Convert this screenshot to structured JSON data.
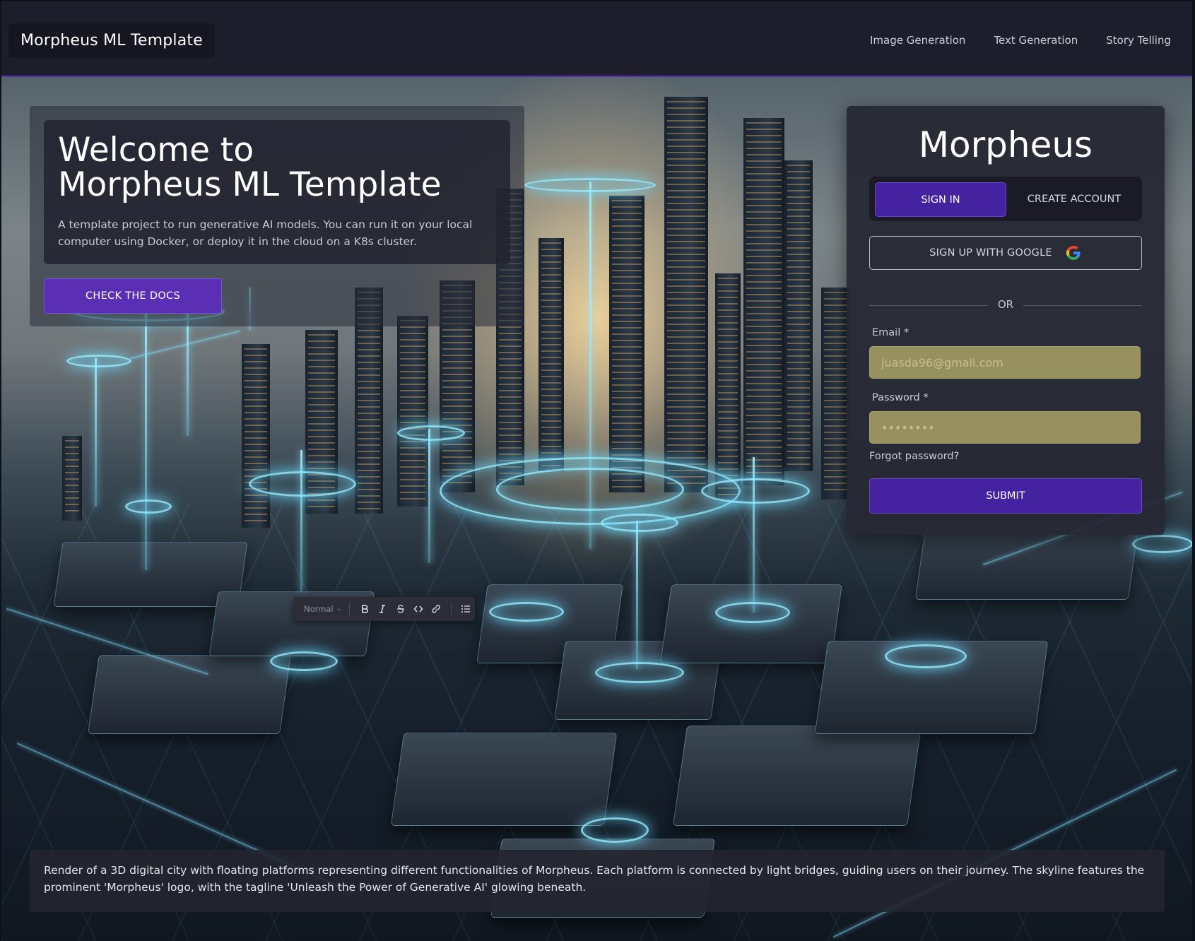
{
  "header": {
    "brand": "Morpheus ML Template",
    "nav": [
      "Image Generation",
      "Text Generation",
      "Story Telling"
    ]
  },
  "hero": {
    "title_line1": "Welcome to",
    "title_line2": "Morpheus ML Template",
    "description": "A template project to run generative AI models. You can run it on your local computer using Docker, or deploy it in the cloud on a K8s cluster.",
    "docs_button": "CHECK THE DOCS"
  },
  "auth": {
    "title": "Morpheus",
    "tab_signin": "SIGN IN",
    "tab_create": "CREATE ACCOUNT",
    "google_button": "SIGN UP WITH GOOGLE",
    "divider": "OR",
    "email_label": "Email *",
    "email_value": "juasda96@gmail.com",
    "password_label": "Password *",
    "password_value": "••••••••",
    "forgot": "Forgot password?",
    "submit": "SUBMIT"
  },
  "toolbar": {
    "format_select": "Normal",
    "buttons": [
      "bold-icon",
      "italic-icon",
      "strikethrough-icon",
      "code-icon",
      "link-icon",
      "bullet-list-icon"
    ]
  },
  "caption": "Render of a 3D digital city with floating platforms representing different functionalities of Morpheus. Each platform is connected by light bridges, guiding users on their journey. The skyline features the prominent 'Morpheus' logo, with the tagline 'Unleash the Power of Generative AI' glowing beneath.",
  "colors": {
    "accent": "#4522a0",
    "header_bg": "#1d1d2b",
    "input_fill": "#979160"
  }
}
